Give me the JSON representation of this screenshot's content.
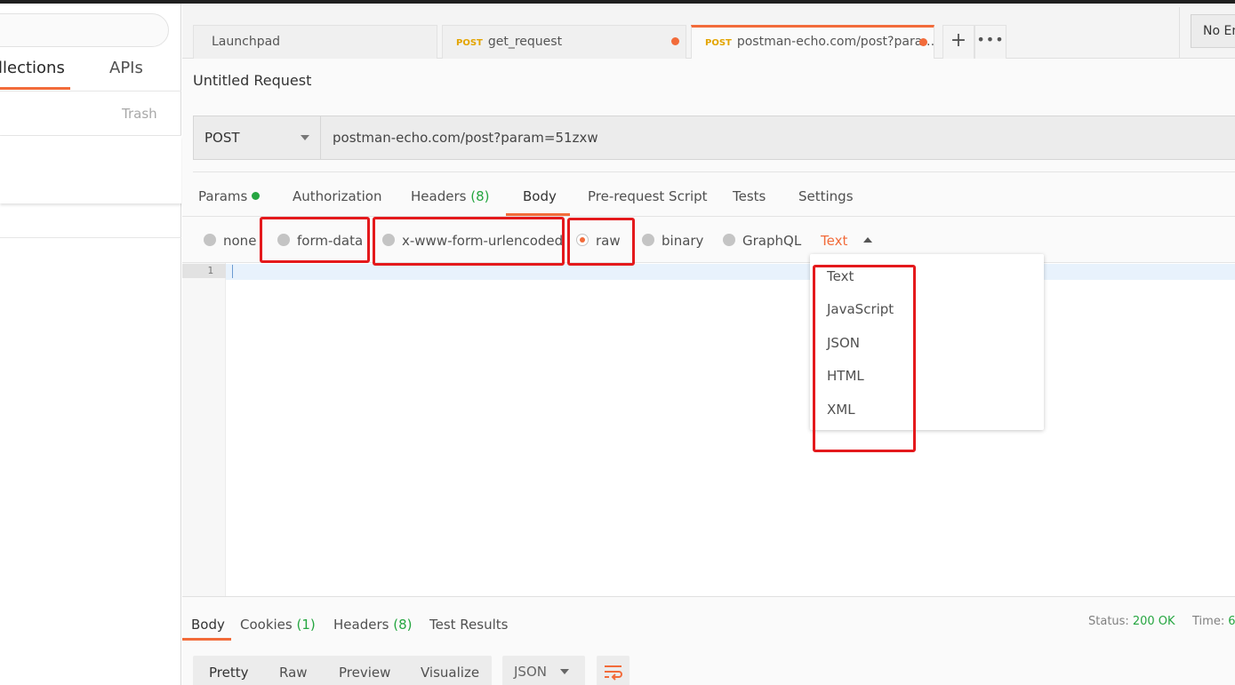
{
  "sidebar": {
    "tabs": [
      {
        "label": "llections"
      },
      {
        "label": "APIs"
      }
    ],
    "trash_label": "Trash"
  },
  "tabs": {
    "items": [
      {
        "label": "Launchpad",
        "method": ""
      },
      {
        "label": "get_request",
        "method": "POST"
      },
      {
        "label": "postman-echo.com/post?para…",
        "method": "POST"
      }
    ],
    "environment": "No En"
  },
  "request": {
    "title": "Untitled Request",
    "method": "POST",
    "url": "postman-echo.com/post?param=51zxw",
    "tabs": {
      "params": "Params",
      "authorization": "Authorization",
      "headers": "Headers",
      "headers_count": "(8)",
      "body": "Body",
      "prerequest": "Pre-request Script",
      "tests": "Tests",
      "settings": "Settings"
    },
    "body_modes": {
      "none": "none",
      "form_data": "form-data",
      "urlencoded": "x-www-form-urlencoded",
      "raw": "raw",
      "binary": "binary",
      "graphql": "GraphQL"
    },
    "raw_type": "Text",
    "raw_type_options": [
      "Text",
      "JavaScript",
      "JSON",
      "HTML",
      "XML"
    ]
  },
  "editor": {
    "line_number": "1"
  },
  "response": {
    "tabs": {
      "body": "Body",
      "cookies": "Cookies",
      "cookies_count": "(1)",
      "headers": "Headers",
      "headers_count": "(8)",
      "test_results": "Test Results"
    },
    "status_label": "Status:",
    "status_value": "200 OK",
    "time_label": "Time:",
    "time_value": "6",
    "views": [
      "Pretty",
      "Raw",
      "Preview",
      "Visualize"
    ],
    "format": "JSON"
  },
  "colors": {
    "accent": "#f26b3a",
    "green": "#26a641",
    "method_post": "#e3a400",
    "highlight": "#e4191c"
  }
}
